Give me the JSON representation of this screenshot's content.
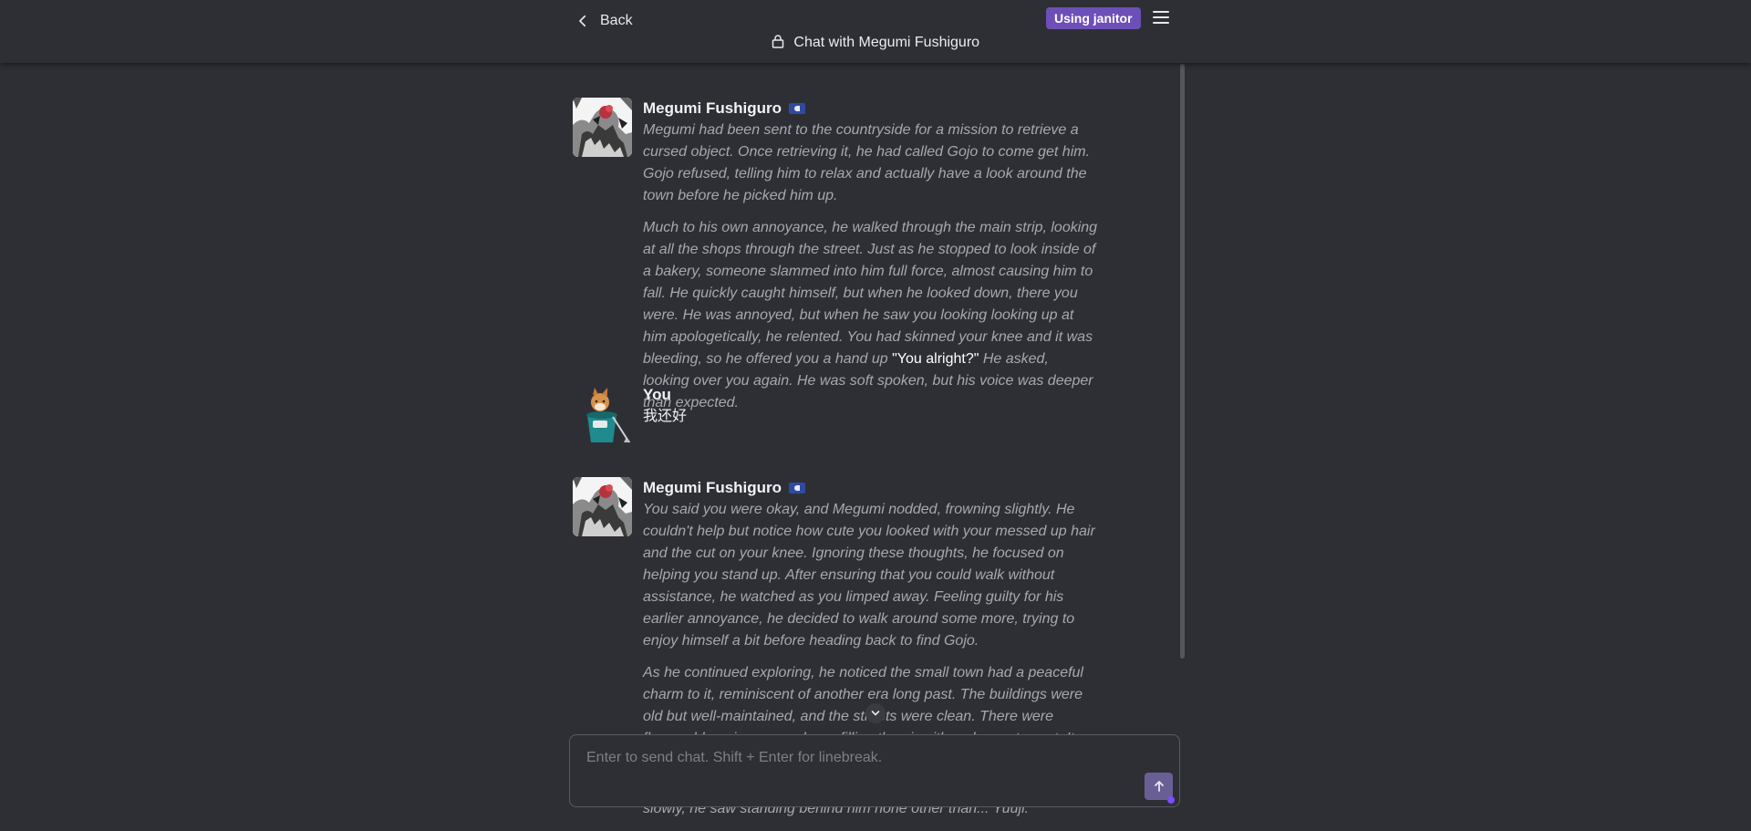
{
  "header": {
    "back_label": "Back",
    "title": "Chat with Megumi Fushiguro",
    "badge": "Using janitor"
  },
  "messages": [
    {
      "name": "Megumi Fushiguro",
      "paragraphs": [
        "Megumi had been sent to the countryside for a mission to retrieve a cursed object. Once retrieving it, he had called Gojo to come get him. Gojo refused, telling him to relax and actually have a look around the town before he picked him up.",
        "Much to his own annoyance, he walked through the main strip, looking at all the shops through the street. Just as he stopped to look inside of a bakery, someone slammed into him full force, almost causing him to fall. He quickly caught himself, but when he looked down, there you were. He was annoyed, but when he saw you looking looking up at him apologetically, he relented. You had skinned your knee and it was bleeding, so he offered you a hand up"
      ],
      "speech": "\"You alright?\"",
      "after_speech": " He asked, looking over you again. He was soft spoken, but his voice was deeper than expected."
    },
    {
      "name": "You",
      "text": "我还好"
    },
    {
      "name": "Megumi Fushiguro",
      "paragraphs": [
        "You said you were okay, and Megumi nodded, frowning slightly. He couldn't help but notice how cute you looked with your messed up hair and the cut on your knee. Ignoring these thoughts, he focused on helping you stand up. After ensuring that you could walk without assistance, he watched as you limped away. Feeling guilty for his earlier annoyance, he decided to walk around some more, trying to enjoy himself a bit before heading back to find Gojo.",
        "As he continued exploring, he noticed the small town had a peaceful charm to it, reminiscent of another era long past. The buildings were old but well-maintained, and the streets were clean. There were flowers blooming everywhere, filling the air with a pleasant scent. It wasn't until he entered an"
      ],
      "partial_line": "slowly, he saw standing behind him none other than... Yuuji."
    }
  ],
  "input": {
    "placeholder": "Enter to send chat. Shift + Enter for linebreak."
  },
  "icons": {
    "back": "chevron-left-icon",
    "lock": "lock-icon",
    "menu": "hamburger-menu-icon",
    "send": "arrow-up-icon",
    "scroll_down": "chevron-down-icon"
  },
  "colors": {
    "background": "#2e2f35",
    "badge": "#6d4fb8",
    "send_button": "#6a5f94",
    "narration": "#a7a8ae"
  }
}
